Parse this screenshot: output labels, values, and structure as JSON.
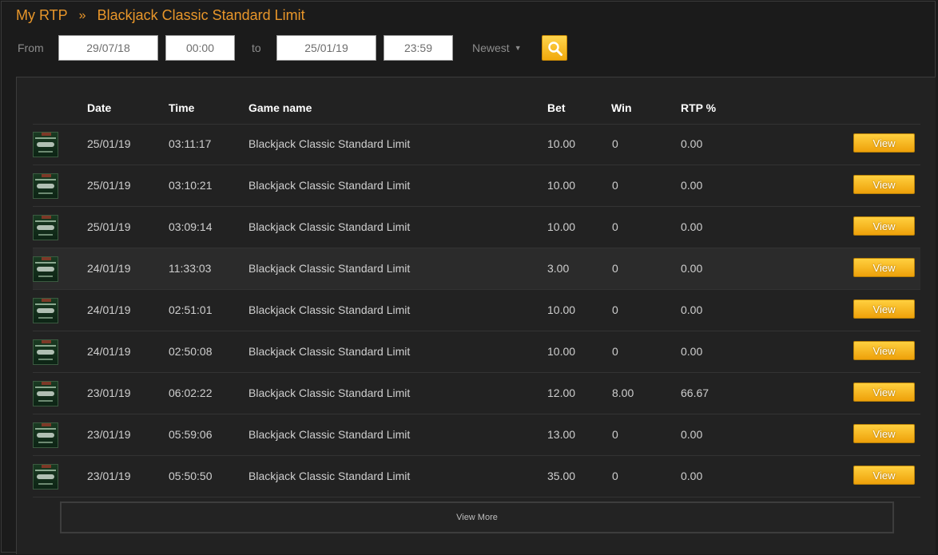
{
  "breadcrumb": {
    "root": "My RTP",
    "separator": "»",
    "current": "Blackjack Classic Standard Limit"
  },
  "filters": {
    "from_label": "From",
    "from_date": "29/07/18",
    "from_time": "00:00",
    "to_label": "to",
    "to_date": "25/01/19",
    "to_time": "23:59",
    "sort_value": "Newest",
    "search_icon": "search-icon"
  },
  "table": {
    "headers": {
      "date": "Date",
      "time": "Time",
      "game": "Game name",
      "bet": "Bet",
      "win": "Win",
      "rtp": "RTP %"
    },
    "view_label": "View",
    "rows": [
      {
        "date": "25/01/19",
        "time": "03:11:17",
        "game": "Blackjack Classic Standard Limit",
        "bet": "10.00",
        "win": "0",
        "rtp": "0.00"
      },
      {
        "date": "25/01/19",
        "time": "03:10:21",
        "game": "Blackjack Classic Standard Limit",
        "bet": "10.00",
        "win": "0",
        "rtp": "0.00"
      },
      {
        "date": "25/01/19",
        "time": "03:09:14",
        "game": "Blackjack Classic Standard Limit",
        "bet": "10.00",
        "win": "0",
        "rtp": "0.00"
      },
      {
        "date": "24/01/19",
        "time": "11:33:03",
        "game": "Blackjack Classic Standard Limit",
        "bet": "3.00",
        "win": "0",
        "rtp": "0.00"
      },
      {
        "date": "24/01/19",
        "time": "02:51:01",
        "game": "Blackjack Classic Standard Limit",
        "bet": "10.00",
        "win": "0",
        "rtp": "0.00"
      },
      {
        "date": "24/01/19",
        "time": "02:50:08",
        "game": "Blackjack Classic Standard Limit",
        "bet": "10.00",
        "win": "0",
        "rtp": "0.00"
      },
      {
        "date": "23/01/19",
        "time": "06:02:22",
        "game": "Blackjack Classic Standard Limit",
        "bet": "12.00",
        "win": "8.00",
        "rtp": "66.67"
      },
      {
        "date": "23/01/19",
        "time": "05:59:06",
        "game": "Blackjack Classic Standard Limit",
        "bet": "13.00",
        "win": "0",
        "rtp": "0.00"
      },
      {
        "date": "23/01/19",
        "time": "05:50:50",
        "game": "Blackjack Classic Standard Limit",
        "bet": "35.00",
        "win": "0",
        "rtp": "0.00"
      }
    ]
  },
  "view_more_label": "View More",
  "colors": {
    "accent": "#e8962a",
    "button": "#f5b820",
    "background": "#1b1b1b",
    "panel": "#222222"
  }
}
